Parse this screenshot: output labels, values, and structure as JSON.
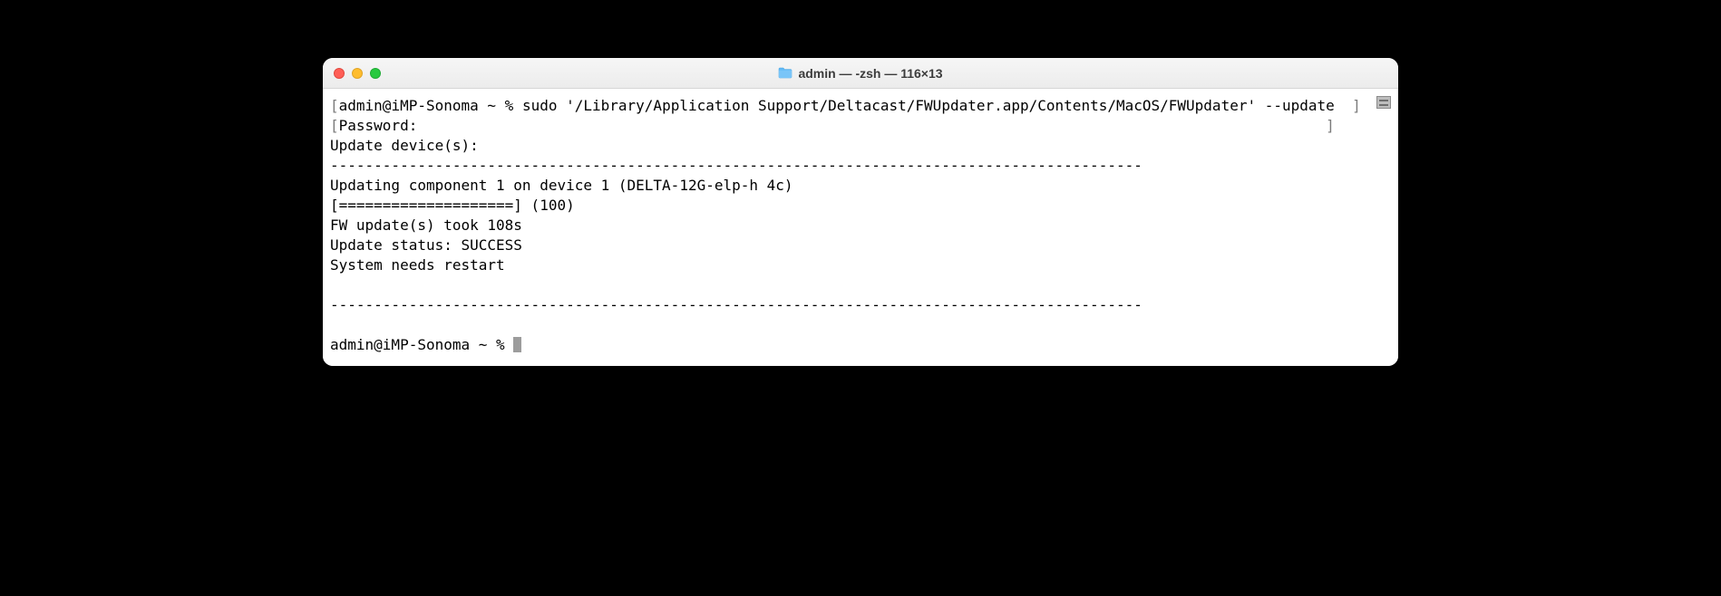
{
  "window": {
    "title": "admin — -zsh — 116×13"
  },
  "terminal": {
    "line1_prompt": "admin@iMP-Sonoma ~ % ",
    "line1_cmd": "sudo '/Library/Application Support/Deltacast/FWUpdater.app/Contents/MacOS/FWUpdater' --update",
    "line2": "Password:",
    "line3": "Update device(s):",
    "line4": "---------------------------------------------------------------------------------------------",
    "line5": "Updating component 1 on device 1 (DELTA-12G-elp-h 4c)",
    "line6": "[====================] (100)",
    "line7": "FW update(s) took 108s",
    "line8": "Update status: SUCCESS",
    "line9": "System needs restart",
    "line10": "",
    "line11": "---------------------------------------------------------------------------------------------",
    "line12": "",
    "line13_prompt": "admin@iMP-Sonoma ~ % "
  }
}
